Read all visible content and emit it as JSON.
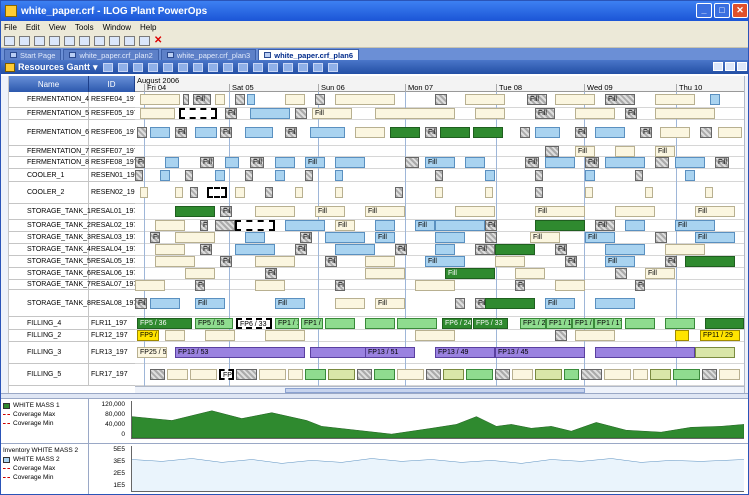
{
  "window": {
    "title": "white_paper.crf - ILOG Plant PowerOps"
  },
  "menu": [
    "File",
    "Edit",
    "View",
    "Tools",
    "Window",
    "Help"
  ],
  "tabs": [
    {
      "label": "Start Page",
      "active": false
    },
    {
      "label": "white_paper.crf_plan2",
      "active": false
    },
    {
      "label": "white_paper.crf_plan3",
      "active": false
    },
    {
      "label": "white_paper.crf_plan6",
      "active": true
    }
  ],
  "gantt": {
    "title": "Resources Gantt",
    "col_name": "Name",
    "col_id": "ID",
    "month": "August 2006",
    "days": [
      "Fri 04",
      "Sat 05",
      "Sun 06",
      "Mon 07",
      "Tue 08",
      "Wed 09",
      "Thu 10"
    ],
    "rows": [
      {
        "name": "FERMENTATION_4",
        "id": "RESFE04_197"
      },
      {
        "name": "FERMENTATION_5",
        "id": "RESFE05_197"
      },
      {
        "name": "FERMENTATION_6",
        "id": "RESFE06_197"
      },
      {
        "name": "FERMENTATION_7",
        "id": "RESFE07_197"
      },
      {
        "name": "FERMENTATION_8",
        "id": "RESFE08_197"
      },
      {
        "name": "COOLER_1",
        "id": "RESEN01_197"
      },
      {
        "name": "COOLER_2",
        "id": "RESEN02_197"
      },
      {
        "name": "STORAGE_TANK_1",
        "id": "RESAL01_197"
      },
      {
        "name": "STORAGE_TANK_2",
        "id": "RESAL02_197"
      },
      {
        "name": "STORAGE_TANK_3",
        "id": "RESAL03_197"
      },
      {
        "name": "STORAGE_TANK_4",
        "id": "RESAL04_197"
      },
      {
        "name": "STORAGE_TANK_5",
        "id": "RESAL05_197"
      },
      {
        "name": "STORAGE_TANK_6",
        "id": "RESAL06_197"
      },
      {
        "name": "STORAGE_TANK_7",
        "id": "RESAL07_197"
      },
      {
        "name": "STORAGE_TANK_8",
        "id": "RESAL08_197"
      },
      {
        "name": "FILLING_4",
        "id": "FLR11_197"
      },
      {
        "name": "FILLING_2",
        "id": "FLR12_197"
      },
      {
        "name": "FILLING_3",
        "id": "FLR13_197"
      },
      {
        "name": "FILLING_5",
        "id": "FLR17_197"
      }
    ],
    "bar_labels": {
      "fill4": [
        "FP5 / 36",
        "FP5 / 55",
        "FP6 / 33",
        "FP1 / 18",
        "FP1 / 25",
        "FP6 / 24",
        "FP5 / 33",
        "FP1 / 20",
        "FP1 / 17",
        "FP1 / 17",
        "FP1 / 17"
      ],
      "fill2": [
        "FP9 / 60",
        "FP11 / 29"
      ],
      "fill3": [
        "FP25 / 52",
        "FP13 / 53",
        "FP13 / 51",
        "FP13 / 49",
        "FP13 / 45"
      ],
      "fill5": [
        "FP15 / 99"
      ],
      "small": "Fill"
    }
  },
  "panels": {
    "p1": {
      "title": "WHITE MASS 1",
      "legend": [
        "WHITE MASS 1",
        "Coverage Max",
        "Coverage Min"
      ],
      "ticks": [
        "120,000",
        "80,000",
        "40,000",
        "0"
      ]
    },
    "p2": {
      "title": "Inventory WHITE MASS 2",
      "legend": [
        "WHITE MASS 2",
        "Coverage Max",
        "Coverage Min"
      ],
      "ticks": [
        "5E5",
        "3E5",
        "2E5",
        "1E5"
      ]
    }
  },
  "colors": {
    "accent": "#2f8a2f",
    "secondary": "#a9d3f0",
    "title": "#1b55d6"
  }
}
